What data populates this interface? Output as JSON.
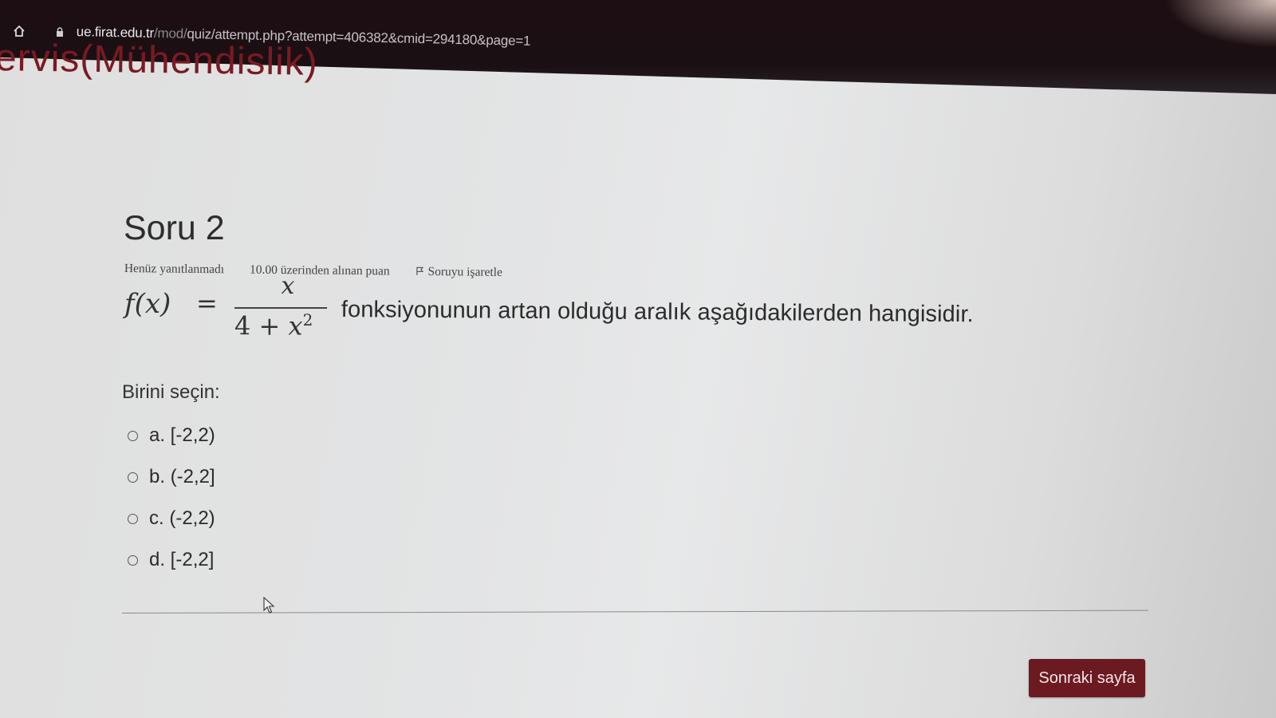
{
  "browser": {
    "url_host": "ue.firat.edu.tr",
    "url_path_dim": "/mod/",
    "url_path": "quiz/attempt.php?attempt=406382&cmid=294180&page=1"
  },
  "site": {
    "title_partial": "ervis(Mühendislik)"
  },
  "question": {
    "title": "Soru 2",
    "status": "Henüz yanıtlanmadı",
    "points": "10.00 üzerinden alınan puan",
    "flag_label": "Soruyu işaretle",
    "formula": {
      "lhs": "f(x)",
      "equals": "=",
      "numerator": "x",
      "denominator_const": "4 + ",
      "denominator_var": "x",
      "denominator_exp": "2"
    },
    "text": "fonksiyonunun artan olduğu aralık  aşağıdakilerden hangisidir.",
    "prompt": "Birini seçin:",
    "options": [
      {
        "label": "a. [-2,2)",
        "selected": false
      },
      {
        "label": "b. (-2,2]",
        "selected": false
      },
      {
        "label": "c. (-2,2)",
        "selected": false
      },
      {
        "label": "d. [-2,2]",
        "selected": false
      }
    ]
  },
  "navigation": {
    "next_label": "Sonraki sayfa"
  },
  "colors": {
    "brand": "#6b1a22",
    "title_red": "#7a1a22"
  },
  "icons": {
    "home": "home-icon",
    "lock": "lock-icon",
    "flag": "flag-icon",
    "cursor": "cursor-icon"
  }
}
